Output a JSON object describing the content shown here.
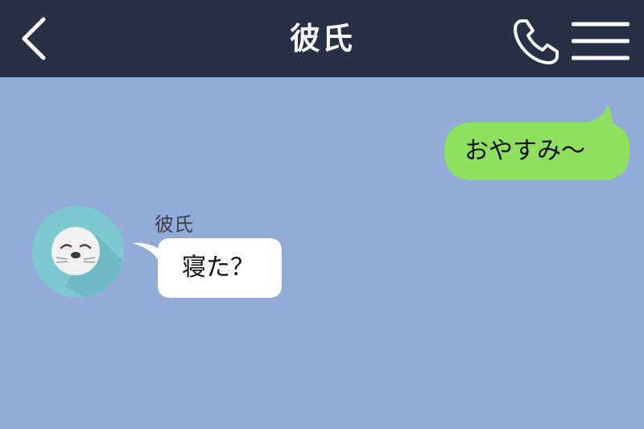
{
  "header": {
    "title": "彼氏",
    "back_icon": "chevron-left-icon",
    "call_icon": "phone-icon",
    "menu_icon": "menu-icon"
  },
  "colors": {
    "header_bg": "#273044",
    "chat_bg": "#94abd7",
    "outgoing_bubble": "#8fdf60",
    "incoming_bubble": "#ffffff",
    "avatar_bg": "#7cc9cf"
  },
  "messages": [
    {
      "direction": "outgoing",
      "text": "おやすみ〜"
    },
    {
      "direction": "incoming",
      "sender": "彼氏",
      "text": "寝た？",
      "avatar_icon": "seal-avatar-icon"
    }
  ]
}
